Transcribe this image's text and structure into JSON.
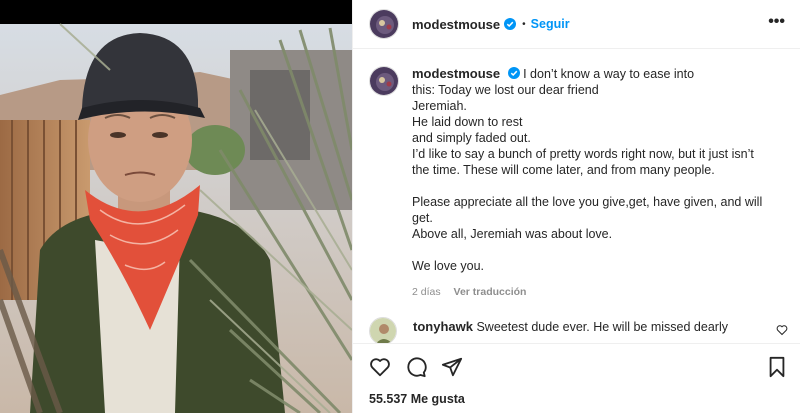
{
  "post": {
    "username": "modestmouse",
    "follow_label": "Seguir",
    "caption_lines": [
      "I don’t know a way to ease into",
      "this: Today we lost our dear friend",
      "Jeremiah.",
      "He laid down to rest",
      "and simply faded out.",
      "I’d like to say a bunch of pretty words right now, but it just isn’t",
      "the time. These will come later, and from many people."
    ],
    "caption_para2": [
      "Please appreciate all the love you give,get, have given, and will",
      "get.",
      "Above all, Jeremiah was about love."
    ],
    "caption_para3": "We love you.",
    "time_ago": "2 días",
    "translate_label": "Ver traducción",
    "likes": "55.537 Me gusta"
  },
  "comment": {
    "username": "tonyhawk",
    "text": "Sweetest dude ever. He will be missed dearly"
  },
  "icons": {
    "verified": "verified-badge-icon",
    "more": "more-options-icon",
    "like": "heart-icon",
    "comment": "comment-icon",
    "share": "share-icon",
    "save": "bookmark-icon"
  },
  "colors": {
    "accent": "#0095f6",
    "text": "#262626",
    "muted": "#8e8e8e",
    "border": "#efefef"
  }
}
